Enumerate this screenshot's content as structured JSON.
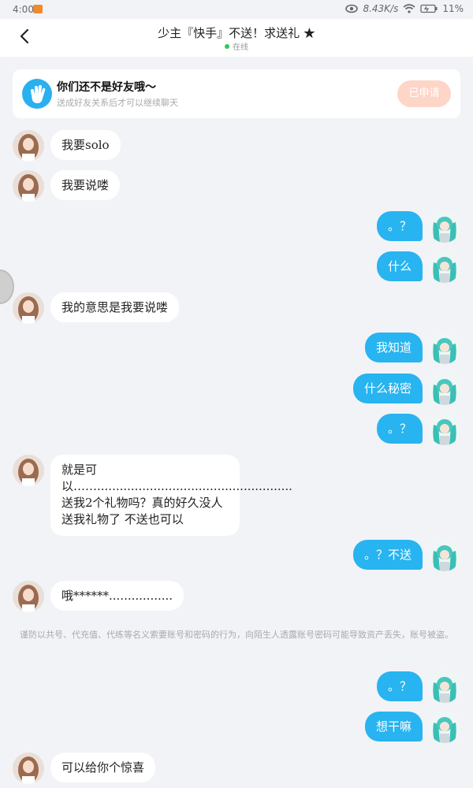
{
  "status_bar": {
    "time": "4:00",
    "net_speed": "8.43K/s",
    "battery": "11%",
    "icons": [
      "app-notification-icon",
      "eye-icon",
      "wifi-icon",
      "battery-icon"
    ]
  },
  "header": {
    "title": "少主『快手』不送！求送礼 ★",
    "status": "在线"
  },
  "friend_card": {
    "title": "你们还不是好友哦～",
    "subtitle": "送成好友关系后才可以继续聊天",
    "button": "已申请"
  },
  "messages": [
    {
      "side": "left",
      "text": "我要solo"
    },
    {
      "side": "left",
      "text": "我要说喽"
    },
    {
      "side": "right",
      "text": "。？"
    },
    {
      "side": "right",
      "text": "什么"
    },
    {
      "side": "left",
      "text": "我的意思是我要说喽"
    },
    {
      "side": "right",
      "text": "我知道"
    },
    {
      "side": "right",
      "text": "什么秘密"
    },
    {
      "side": "right",
      "text": "。？"
    },
    {
      "side": "left",
      "text": "就是可以……....................................................送我2个礼物吗？真的好久没人送我礼物了 不送也可以"
    },
    {
      "side": "right",
      "text": "。？不送"
    },
    {
      "side": "left",
      "text": "哦******................."
    },
    {
      "side": "right",
      "text": "。？"
    },
    {
      "side": "right",
      "text": "想干嘛"
    },
    {
      "side": "left",
      "text": "可以给你个惊喜"
    }
  ],
  "notice": "谨防以共号、代充值、代练等名义索要账号和密码的行为，向陌生人透露账号密码可能导致资产丢失，账号被盗。",
  "colors": {
    "accent": "#27b4f0",
    "background": "#f2f3f7",
    "online": "#2fc95b",
    "applied_button": "#fdd6c8"
  }
}
